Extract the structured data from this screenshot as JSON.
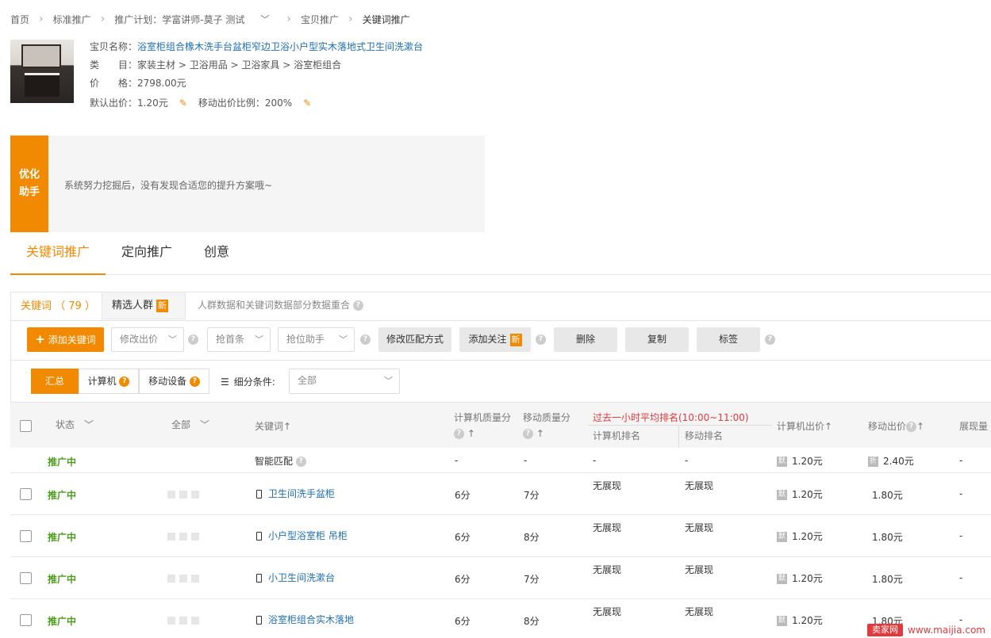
{
  "breadcrumb": {
    "home": "首页",
    "standard": "标准推广",
    "plan": "推广计划：学富讲师-莫子 测试",
    "item": "宝贝推广",
    "current": "关键词推广"
  },
  "product": {
    "name_label": "宝贝名称：",
    "name": "浴室柜组合橡木洗手台盆柜窄边卫浴小户型实木落地式卫生间洗漱台",
    "category_label": "类　　目：",
    "category": "家装主材 > 卫浴用品 > 卫浴家具 > 浴室柜组合",
    "price_label": "价　　格：",
    "price": "2798.00元",
    "default_bid_label": "默认出价：",
    "default_bid": "1.20元",
    "mobile_ratio_label": "移动出价比例：",
    "mobile_ratio": "200%"
  },
  "optimizer": {
    "badge": "优化助手",
    "message": "系统努力挖掘后，没有发现合适您的提升方案哦~"
  },
  "main_tabs": [
    "关键词推广",
    "定向推广",
    "创意"
  ],
  "sub_tabs": {
    "keywords": "关键词 （ 79 ）",
    "crowd": "精选人群",
    "new_tag": "新",
    "note": "人群数据和关键词数据部分数据重合"
  },
  "toolbar": {
    "add": "添加关键词",
    "modify_bid": "修改出价",
    "grab_top": "抢首条",
    "rank_helper": "抢位助手",
    "match": "修改匹配方式",
    "follow": "添加关注",
    "follow_tag": "新",
    "delete": "删除",
    "copy": "复制",
    "tag": "标签"
  },
  "filter": {
    "all": "汇总",
    "pc": "计算机",
    "mobile": "移动设备",
    "label": "细分条件:",
    "select": "全部"
  },
  "table": {
    "headers": {
      "status": "状态",
      "all": "全部",
      "keyword": "关键词",
      "pc_quality": "计算机质量分",
      "mobile_quality": "移动质量分",
      "rank_group": "过去一小时平均排名(10:00~11:00)",
      "pc_rank": "计算机排名",
      "mobile_rank": "移动排名",
      "pc_bid": "计算机出价",
      "mobile_bid": "移动出价",
      "impressions": "展现量"
    },
    "smart": {
      "status": "推广中",
      "keyword": "智能匹配",
      "pcq": "-",
      "mq": "-",
      "pcr": "-",
      "mr": "-",
      "pcbid": "1.20元",
      "mbid": "2.40元",
      "imp": "-",
      "pc_icon": "默",
      "m_icon": "折"
    },
    "rows": [
      {
        "status": "推广中",
        "keyword": "卫生间洗手盆柜",
        "pcq": "6分",
        "mq": "7分",
        "pcr": "无展现",
        "mr": "无展现",
        "pcbid": "1.20元",
        "mbid": "1.80元",
        "imp": "-"
      },
      {
        "status": "推广中",
        "keyword": "小户型浴室柜 吊柜",
        "pcq": "6分",
        "mq": "8分",
        "pcr": "无展现",
        "mr": "无展现",
        "pcbid": "1.20元",
        "mbid": "1.80元",
        "imp": "-"
      },
      {
        "status": "推广中",
        "keyword": "小卫生间洗漱台",
        "pcq": "6分",
        "mq": "7分",
        "pcr": "无展现",
        "mr": "无展现",
        "pcbid": "1.20元",
        "mbid": "1.80元",
        "imp": "-"
      },
      {
        "status": "推广中",
        "keyword": "浴室柜组合实木落地",
        "pcq": "6分",
        "mq": "8分",
        "pcr": "无展现",
        "mr": "无展现",
        "pcbid": "1.20元",
        "mbid": "1.80元",
        "imp": "-"
      }
    ]
  },
  "watermark": {
    "a": "卖家网",
    "b": "www.maijia.com"
  }
}
